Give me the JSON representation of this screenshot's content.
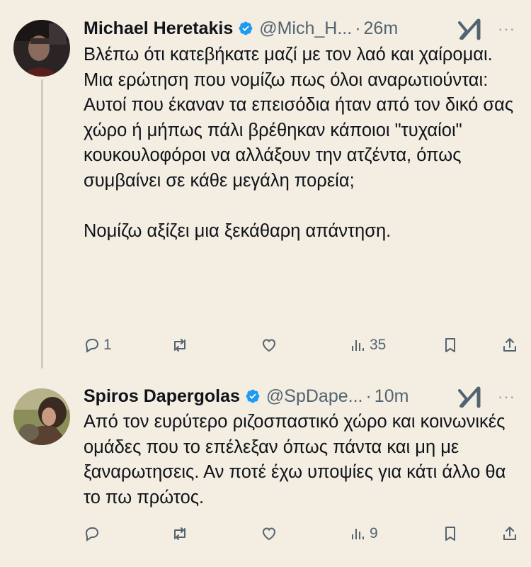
{
  "tweets": [
    {
      "display_name": "Michael Heretakis",
      "handle": "@Mich_H...",
      "separator": "·",
      "time": "26m",
      "text": "Βλέπω ότι κατεβήκατε μαζί με τον λαό και χαίρομαι.\nΜια ερώτηση που νομίζω πως όλοι αναρωτιούνται:\nΑυτοί που έκαναν τα επεισόδια ήταν από τον δικό σας χώρο ή μήπως πάλι βρέθηκαν κάποιοι \"τυχαίοι\" κουκουλοφόροι να αλλάξουν την ατζέντα, όπως συμβαίνει σε κάθε μεγάλη πορεία;\n\nΝομίζω αξίζει μια ξεκάθαρη απάντηση.",
      "replies": "1",
      "reposts": "",
      "likes": "",
      "views": "35"
    },
    {
      "display_name": "Spiros Dapergolas",
      "handle": "@SpDape...",
      "separator": "·",
      "time": "10m",
      "text": "Από τον ευρύτερο ριζοσπαστικό χώρο  και κοινωνικές ομάδες που το επέλεξαν όπως πάντα και μη με ξαναρωτησεις. Αν ποτέ έχω υποψίες για κάτι άλλο θα το πω πρώτος.",
      "replies": "",
      "reposts": "",
      "likes": "",
      "views": "9"
    }
  ],
  "more_label": "···",
  "colors": {
    "background": "#f3ede2",
    "text": "#0f1419",
    "secondary": "#536471",
    "verified": "#1d9bf0"
  },
  "icons": [
    "verified-badge-icon",
    "grok-icon",
    "more-icon",
    "reply-icon",
    "repost-icon",
    "like-icon",
    "views-icon",
    "bookmark-icon",
    "share-icon"
  ]
}
